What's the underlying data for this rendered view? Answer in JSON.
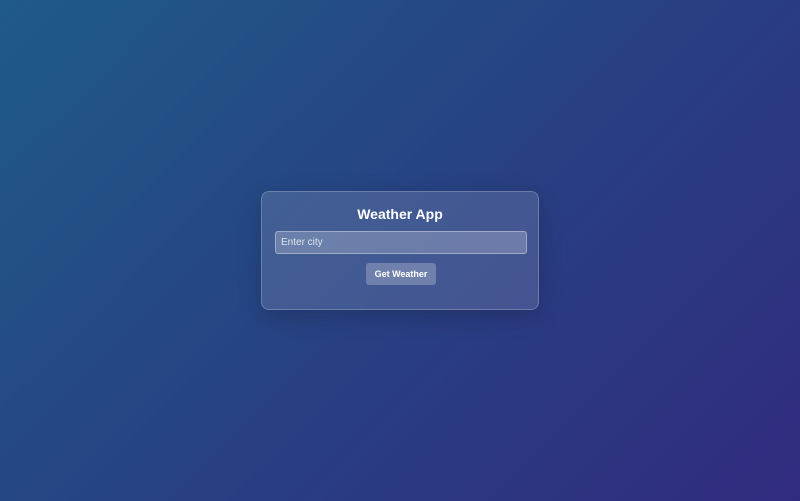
{
  "app": {
    "title": "Weather App"
  },
  "search": {
    "placeholder": "Enter city",
    "value": ""
  },
  "actions": {
    "get_weather_label": "Get Weather"
  },
  "colors": {
    "background_start": "#1f5a8a",
    "background_end": "#312b7f",
    "text": "#ffffff"
  }
}
